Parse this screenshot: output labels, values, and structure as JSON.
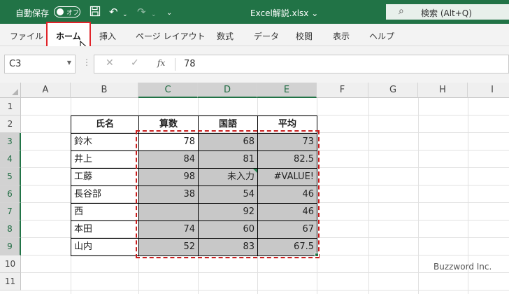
{
  "titlebar": {
    "autosave_label": "自動保存",
    "autosave_state": "オフ",
    "document_title": "Excel解説.xlsx ⌄",
    "search_placeholder": "検索 (Alt+Q)"
  },
  "ribbon": {
    "tabs": [
      "ファイル",
      "ホーム",
      "挿入",
      "ページ レイアウト",
      "数式",
      "データ",
      "校閲",
      "表示",
      "ヘルプ"
    ],
    "active_tab": "ホーム"
  },
  "formula_bar": {
    "name_box": "C3",
    "fx_label": "fx",
    "value": "78"
  },
  "grid": {
    "columns": [
      "A",
      "B",
      "C",
      "D",
      "E",
      "F",
      "G",
      "H",
      "I"
    ],
    "rows": [
      "1",
      "2",
      "3",
      "4",
      "5",
      "6",
      "7",
      "8",
      "9",
      "10",
      "11"
    ],
    "selected_columns": [
      "C",
      "D",
      "E"
    ],
    "selected_rows": [
      "3",
      "4",
      "5",
      "6",
      "7",
      "8",
      "9"
    ]
  },
  "table": {
    "headers": [
      "氏名",
      "算数",
      "国語",
      "平均"
    ],
    "rows": [
      [
        "鈴木",
        "78",
        "68",
        "73"
      ],
      [
        "井上",
        "84",
        "81",
        "82.5"
      ],
      [
        "工藤",
        "98",
        "未入力",
        "#VALUE!"
      ],
      [
        "長谷部",
        "38",
        "54",
        "46"
      ],
      [
        "西",
        "",
        "92",
        "46"
      ],
      [
        "本田",
        "74",
        "60",
        "67"
      ],
      [
        "山内",
        "52",
        "83",
        "67.5"
      ]
    ]
  },
  "colors": {
    "titlebar": "#217346",
    "selection_fill": "#c8c8c8",
    "marching_ants": "#c81e1e",
    "active_tab_highlight": "#e0242a"
  },
  "watermark": "Buzzword Inc."
}
